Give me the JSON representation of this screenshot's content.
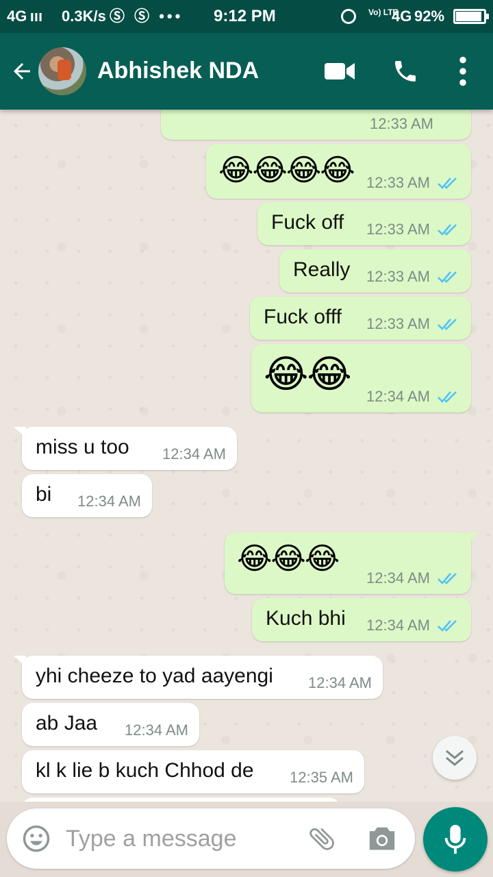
{
  "status_bar": {
    "signal": "4G ııı",
    "speed": "0.3K/s",
    "notification_icons": "Ⓢ Ⓢ •••",
    "time": "9:12 PM",
    "volte": "Vo) LTE",
    "network": "4G",
    "battery_percent": "92%",
    "battery_level": 0.92
  },
  "header": {
    "contact_name": "Abhishek NDA"
  },
  "messages": [
    {
      "direction": "out",
      "text": "",
      "time": "12:33 AM",
      "ticks": false
    },
    {
      "direction": "out",
      "text": "😂😂😂😂",
      "time": "12:33 AM",
      "ticks": true
    },
    {
      "direction": "out",
      "text": "Fuck off",
      "time": "12:33 AM",
      "ticks": true
    },
    {
      "direction": "out",
      "text": "Really",
      "time": "12:33 AM",
      "ticks": true
    },
    {
      "direction": "out",
      "text": "Fuck offf",
      "time": "12:33 AM",
      "ticks": true
    },
    {
      "direction": "out",
      "text": "😂😂",
      "time": "12:34 AM",
      "ticks": true
    },
    {
      "direction": "in",
      "text": "miss u too",
      "time": "12:34 AM"
    },
    {
      "direction": "in",
      "text": "bi",
      "time": "12:34 AM"
    },
    {
      "direction": "out",
      "text": "😂😂😂",
      "time": "12:34 AM",
      "ticks": true
    },
    {
      "direction": "out",
      "text": "Kuch bhi",
      "time": "12:34 AM",
      "ticks": true
    },
    {
      "direction": "in",
      "text": "yhi cheeze to yad aayengi",
      "time": "12:34 AM"
    },
    {
      "direction": "in",
      "text": "ab Jaa",
      "time": "12:34 AM"
    },
    {
      "direction": "in",
      "text": "kl k lie b kuch Chhod de",
      "time": "12:35 AM"
    }
  ],
  "composer": {
    "placeholder": "Type a message"
  },
  "colors": {
    "header": "#075e54",
    "status_bar": "#054d44",
    "outgoing_bubble": "#dcf8c6",
    "incoming_bubble": "#ffffff",
    "read_tick": "#4fc3f7",
    "mic_button": "#00897b"
  },
  "icons": [
    "back-arrow-icon",
    "video-call-icon",
    "voice-call-icon",
    "more-options-icon",
    "double-tick-icon",
    "scroll-down-icon",
    "emoji-icon",
    "attach-icon",
    "camera-icon",
    "mic-icon"
  ]
}
